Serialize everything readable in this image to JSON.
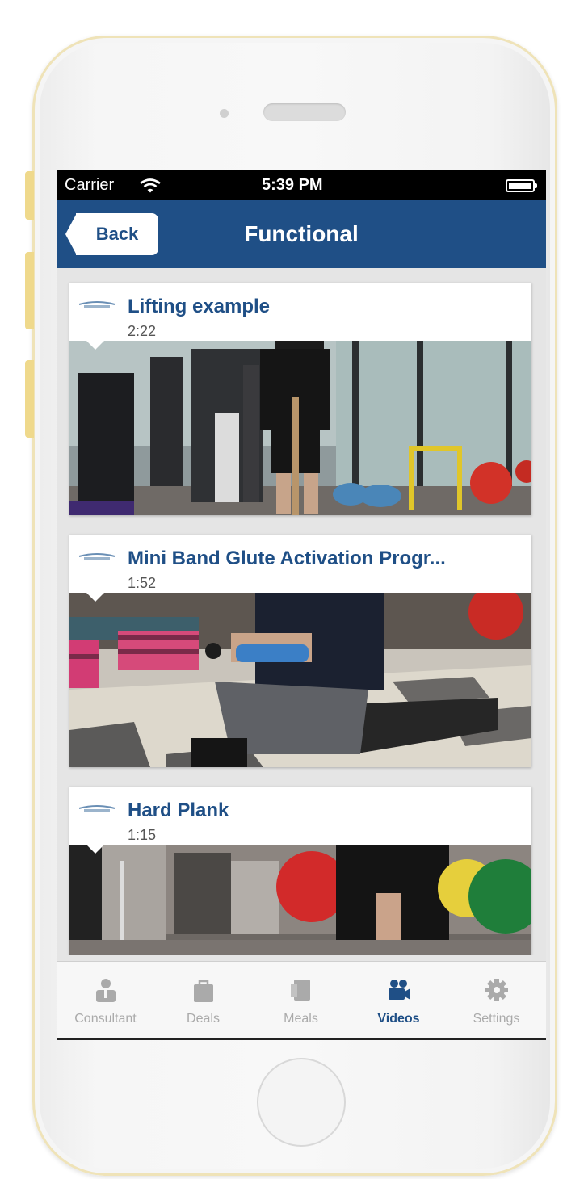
{
  "status_bar": {
    "carrier": "Carrier",
    "time": "5:39 PM"
  },
  "nav": {
    "back_label": "Back",
    "title": "Functional"
  },
  "videos": [
    {
      "title": "Lifting example",
      "duration": "2:22"
    },
    {
      "title": "Mini Band Glute Activation Progr...",
      "duration": "1:52"
    },
    {
      "title": "Hard Plank",
      "duration": "1:15"
    }
  ],
  "tabs": [
    {
      "label": "Consultant",
      "icon": "consultant-icon",
      "active": false
    },
    {
      "label": "Deals",
      "icon": "bag-icon",
      "active": false
    },
    {
      "label": "Meals",
      "icon": "meals-icon",
      "active": false
    },
    {
      "label": "Videos",
      "icon": "video-camera-icon",
      "active": true
    },
    {
      "label": "Settings",
      "icon": "gear-icon",
      "active": false
    }
  ],
  "colors": {
    "brand_blue": "#1f4f86",
    "tab_inactive": "#aaaaaa"
  }
}
